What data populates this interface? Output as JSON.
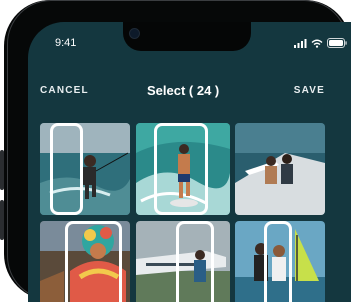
{
  "status_bar": {
    "time": "9:41",
    "icons": [
      "cellular-signal-icon",
      "wifi-icon",
      "battery-icon"
    ]
  },
  "header": {
    "cancel_label": "CANCEL",
    "title": "Select ( 24 )",
    "save_label": "SAVE"
  },
  "grid": {
    "tiles": [
      {
        "subject": "kitesurfer riding wave",
        "selected": true
      },
      {
        "subject": "surfer on wave",
        "selected": true
      },
      {
        "subject": "couple on boat deck",
        "selected": false
      },
      {
        "subject": "festival costume with feathers",
        "selected": true
      },
      {
        "subject": "person near aircraft",
        "selected": true
      },
      {
        "subject": "couple by sailboat",
        "selected": true
      }
    ]
  },
  "colors": {
    "background": "#14373f",
    "text": "#ffffff",
    "selection_border": "#ffffff"
  }
}
